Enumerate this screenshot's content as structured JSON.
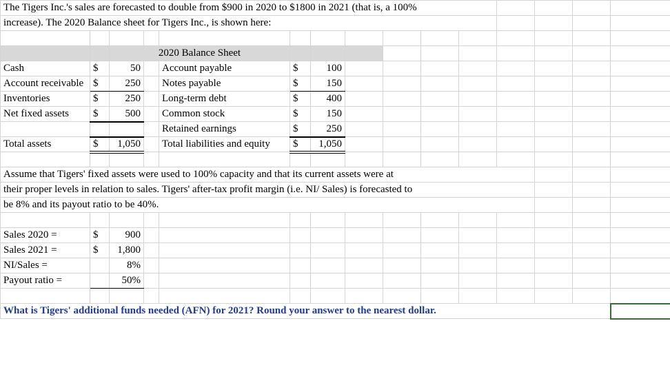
{
  "intro": {
    "line1": "The Tigers Inc.'s sales are forecasted to double from $900 in 2020 to $1800 in 2021 (that is, a 100%",
    "line2": "increase). The 2020 Balance sheet for Tigers Inc., is shown here:"
  },
  "bs": {
    "title": "2020 Balance Sheet",
    "assets": {
      "cash": {
        "label": "Cash",
        "cur": "$",
        "val": "50"
      },
      "ar": {
        "label": "Account receivable",
        "cur": "$",
        "val": "250"
      },
      "inv": {
        "label": "Inventories",
        "cur": "$",
        "val": "250"
      },
      "nfa": {
        "label": "Net fixed assets",
        "cur": "$",
        "val": "500"
      },
      "total": {
        "label": " Total assets",
        "cur": "$",
        "val": "1,050"
      }
    },
    "liab": {
      "ap": {
        "label": "Account payable",
        "cur": "$",
        "val": "100"
      },
      "np": {
        "label": "Notes payable",
        "cur": "$",
        "val": "150"
      },
      "ltd": {
        "label": "Long-term debt",
        "cur": "$",
        "val": "400"
      },
      "cs": {
        "label": "Common stock",
        "cur": "$",
        "val": "150"
      },
      "re": {
        "label": "Retained earnings",
        "cur": "$",
        "val": "250"
      },
      "total": {
        "label": " Total liabilities and equity",
        "cur": "$",
        "val": "1,050"
      }
    }
  },
  "assume": {
    "line1": "Assume that Tigers' fixed assets were used to 100% capacity and that its current assets were at",
    "line2": "their proper levels in relation to sales. Tigers' after-tax profit margin (i.e. NI/ Sales) is forecasted to",
    "line3": "be 8% and its payout ratio to be 40%."
  },
  "inputs": {
    "s2020": {
      "label": "Sales 2020 =",
      "cur": "$",
      "val": "900"
    },
    "s2021": {
      "label": "Sales 2021 =",
      "cur": "$",
      "val": "1,800"
    },
    "nisales": {
      "label": "NI/Sales =",
      "val": "8%"
    },
    "payout": {
      "label": "Payout ratio =",
      "val": "50%"
    }
  },
  "question": "What is Tigers' additional funds needed (AFN) for 2021? Round your answer to the nearest dollar."
}
